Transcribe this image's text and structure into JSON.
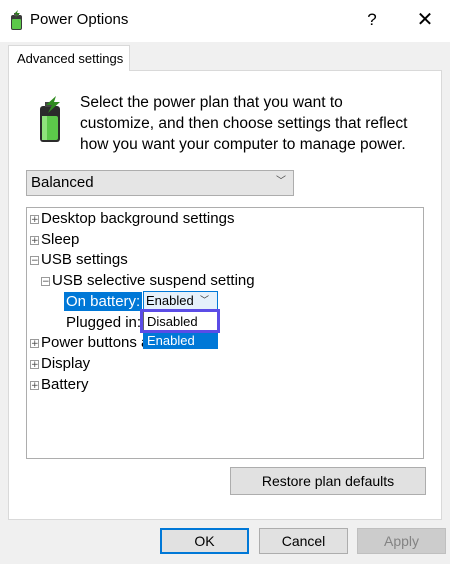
{
  "window": {
    "title": "Power Options",
    "help_glyph": "?",
    "close_glyph": "✕"
  },
  "tab": {
    "label": "Advanced settings"
  },
  "description": "Select the power plan that you want to customize, and then choose settings that reflect how you want your computer to manage power.",
  "plan_select": {
    "value": "Balanced",
    "chevron": "﹀"
  },
  "tree": {
    "items": [
      {
        "expander": "+",
        "label": "Desktop background settings"
      },
      {
        "expander": "+",
        "label": "Sleep"
      },
      {
        "expander": "−",
        "label": "USB settings"
      },
      {
        "expander": "−",
        "label": "USB selective suspend setting"
      },
      {
        "label": "On battery:",
        "selected": true
      },
      {
        "label": "Plugged in:"
      },
      {
        "expander": "+",
        "label": "Power buttons and lid"
      },
      {
        "expander": "+",
        "label": "Display"
      },
      {
        "expander": "+",
        "label": "Battery"
      }
    ],
    "on_battery_value": "Enabled",
    "on_battery_chevron": "﹀",
    "dropdown_options": [
      "Disabled",
      "Enabled"
    ],
    "dropdown_highlighted": "Enabled",
    "dropdown_outlined": "Disabled"
  },
  "buttons": {
    "restore": "Restore plan defaults",
    "ok": "OK",
    "cancel": "Cancel",
    "apply": "Apply"
  },
  "colors": {
    "accent": "#0078d7",
    "highlight_outline": "#5b4ce6"
  }
}
